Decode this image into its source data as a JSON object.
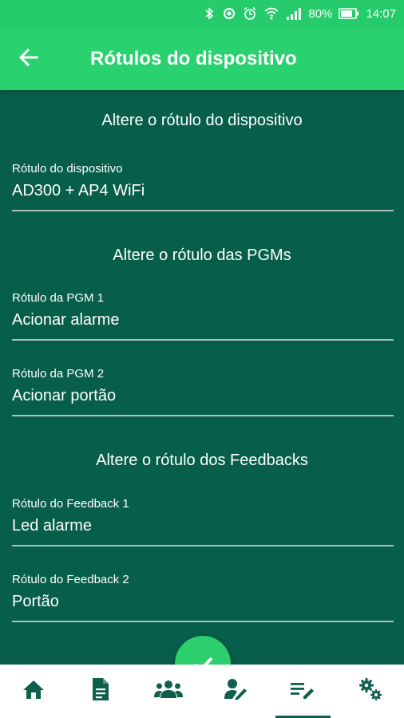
{
  "status_bar": {
    "icons": [
      "bluetooth-icon",
      "sync-icon",
      "alarm-icon",
      "wifi-icon",
      "signal-icon",
      "battery-icon"
    ],
    "battery": "80%",
    "time": "14:07"
  },
  "app_bar": {
    "title": "Rótulos do dispositivo",
    "back_icon": "arrow-left-icon"
  },
  "sections": [
    {
      "title": "Altere o rótulo do dispositivo",
      "fields": [
        {
          "label": "Rótulo do dispositivo",
          "value": "AD300 + AP4 WiFi"
        }
      ]
    },
    {
      "title": "Altere o rótulo das PGMs",
      "fields": [
        {
          "label": "Rótulo da PGM 1",
          "value": "Acionar alarme"
        },
        {
          "label": "Rótulo da PGM 2",
          "value": "Acionar portão"
        }
      ]
    },
    {
      "title": "Altere o rótulo dos Feedbacks",
      "fields": [
        {
          "label": "Rótulo do Feedback 1",
          "value": "Led alarme"
        },
        {
          "label": "Rótulo do Feedback 2",
          "value": "Portão"
        }
      ]
    }
  ],
  "fab": {
    "icon": "check-icon"
  },
  "bottom_nav": {
    "items": [
      {
        "icon": "home-icon",
        "active": false
      },
      {
        "icon": "document-icon",
        "active": false
      },
      {
        "icon": "users-icon",
        "active": false
      },
      {
        "icon": "user-edit-icon",
        "active": false
      },
      {
        "icon": "list-edit-icon",
        "active": true
      },
      {
        "icon": "settings-icon",
        "active": false
      }
    ]
  },
  "colors": {
    "background": "#075e4a",
    "app_bar": "#29d26f",
    "status_bar": "#26cc6c",
    "accent": "#2dcf6d",
    "nav_icon": "#0f5f4c"
  }
}
